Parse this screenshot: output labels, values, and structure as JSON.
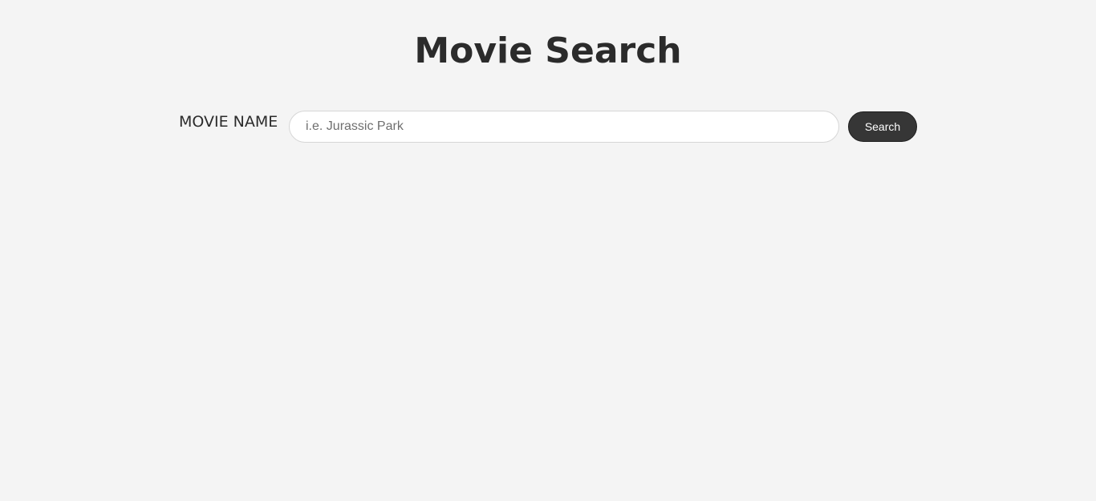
{
  "page": {
    "title": "Movie Search"
  },
  "search": {
    "label": "MOVIE NAME",
    "placeholder": "i.e. Jurassic Park",
    "value": "",
    "button_label": "Search"
  },
  "colors": {
    "background": "#f4f4f4",
    "text": "#2b2b2b",
    "button_bg": "#363636",
    "button_text": "#ffffff"
  }
}
